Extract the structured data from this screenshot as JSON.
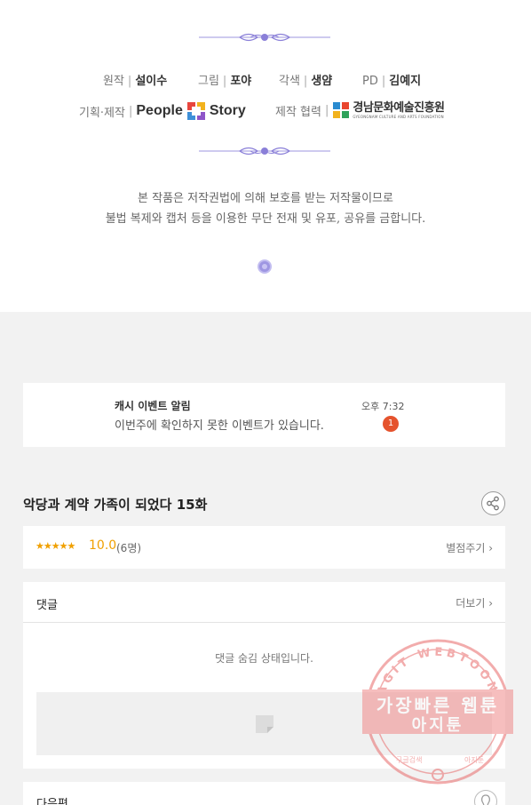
{
  "credits": {
    "original": {
      "role": "원작",
      "name": "설이수"
    },
    "art": {
      "role": "그림",
      "name": "포야"
    },
    "adapt": {
      "role": "각색",
      "name": "생얌"
    },
    "pd": {
      "role": "PD",
      "name": "김예지"
    },
    "planning": {
      "role": "기획·제작",
      "logo_left": "People",
      "logo_right": "Story"
    },
    "coproduction": {
      "role": "제작 협력",
      "logo_ko": "경남문화예술진흥원",
      "logo_en": "GYEONGNAM CULTURE AND ARTS FOUNDATION"
    },
    "separator": "|"
  },
  "notice": {
    "line1": "본 작품은 저작권법에 의해 보호를 받는 저작물이므로",
    "line2": "불법 복제와 캡처 등을 이용한 무단 전재 및 유포, 공유를 금합니다."
  },
  "event": {
    "title": "캐시 이벤트 알림",
    "description": "이번주에 확인하지 못한 이벤트가 있습니다.",
    "time": "오후 7:32",
    "badge": "1"
  },
  "episode": {
    "title": "악당과 계약 가족이 되었다 15화",
    "share_icon": "share-icon"
  },
  "rating": {
    "stars": "★★★★★",
    "score": "10.0",
    "votes": "(6명)",
    "rate_link": "별점주기 ›"
  },
  "comments": {
    "label": "댓글",
    "more": "더보기 ›",
    "hidden_message": "댓글 숨김 상태입니다."
  },
  "next": {
    "label": "다음편"
  },
  "watermark": {
    "arc_text": "AGIT WEBTOON",
    "line1": "가장빠른 웹툰",
    "line2": "아지툰",
    "bottom_left": "구글검색",
    "bottom_right": "아지툰"
  },
  "colors": {
    "accent_purple": "#8a7fd8",
    "badge_red": "#e5532d",
    "star_orange": "#f0a000",
    "watermark_red": "#e86a6a"
  }
}
